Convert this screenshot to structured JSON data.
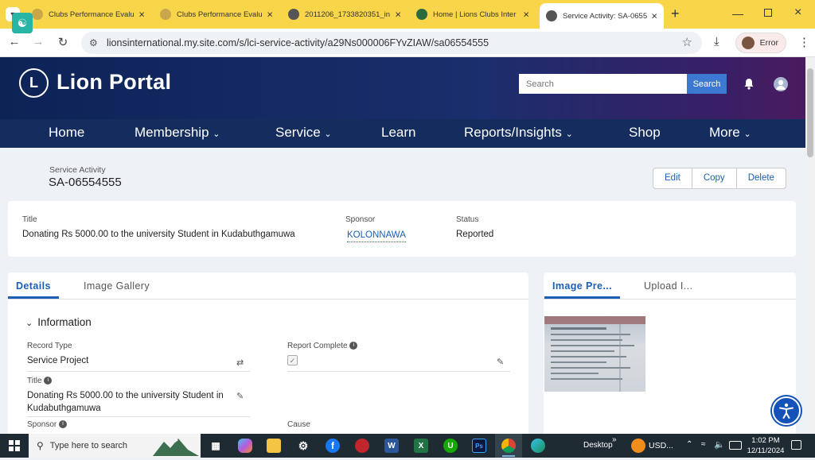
{
  "browser": {
    "tabs": [
      {
        "title": "Clubs Performance Evalu",
        "color": "#c9a64a"
      },
      {
        "title": "Clubs Performance Evalu",
        "color": "#c9a64a"
      },
      {
        "title": "2011206_1733820351_in",
        "color": "#555555"
      },
      {
        "title": "Home | Lions Clubs Inter",
        "color": "#2d6a3e"
      },
      {
        "title": "Service Activity: SA-0655",
        "color": "#555555"
      }
    ],
    "new_tab": "+",
    "url": "lionsinternational.my.site.com/s/lci-service-activity/a29Ns000006FYvZIAW/sa06554555",
    "profile_label": "Error"
  },
  "portal": {
    "brand": "Lion Portal",
    "logo_letter": "L",
    "search_placeholder": "Search",
    "search_button": "Search",
    "nav": [
      {
        "label": "Home",
        "dropdown": false
      },
      {
        "label": "Membership",
        "dropdown": true
      },
      {
        "label": "Service",
        "dropdown": true
      },
      {
        "label": "Learn",
        "dropdown": false
      },
      {
        "label": "Reports/Insights",
        "dropdown": true
      },
      {
        "label": "Shop",
        "dropdown": false
      },
      {
        "label": "More",
        "dropdown": true
      }
    ]
  },
  "record": {
    "object_label": "Service Activity",
    "name": "SA-06554555",
    "actions": [
      "Edit",
      "Copy",
      "Delete"
    ],
    "highlights": {
      "title_label": "Title",
      "title_value": "Donating Rs 5000.00 to the university Student in Kudabuthgamuwa",
      "sponsor_label": "Sponsor",
      "sponsor_value": "KOLONNAWA",
      "status_label": "Status",
      "status_value": "Reported"
    }
  },
  "details": {
    "tabs": [
      "Details",
      "Image Gallery"
    ],
    "section_title": "Information",
    "record_type_label": "Record Type",
    "record_type_value": "Service Project",
    "report_complete_label": "Report Complete",
    "title_label": "Title",
    "title_value": "Donating Rs 5000.00 to the university Student in Kudabuthgamuwa",
    "sponsor_label": "Sponsor",
    "cause_label": "Cause"
  },
  "side_panel": {
    "tabs": [
      "Image Pre...",
      "Upload I..."
    ]
  },
  "taskbar": {
    "search_placeholder": "Type here to search",
    "desktop_label": "Desktop",
    "currency_label": "USD...",
    "time": "1:02 PM",
    "date": "12/11/2024"
  }
}
